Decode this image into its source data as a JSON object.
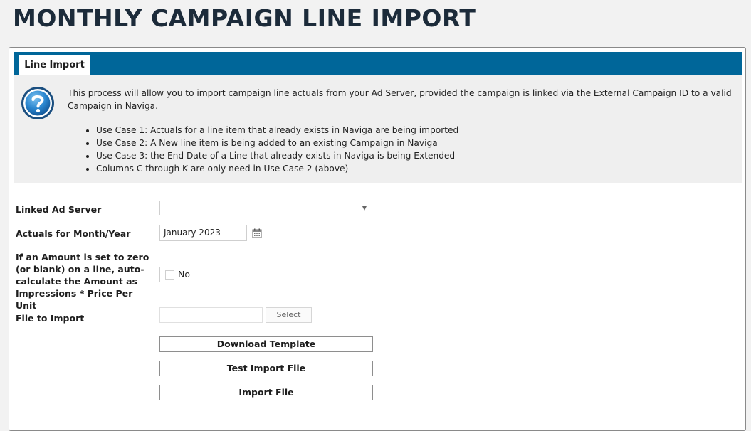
{
  "page": {
    "title": "MONTHLY CAMPAIGN LINE IMPORT"
  },
  "tabs": [
    {
      "label": "Line Import",
      "active": true
    }
  ],
  "info": {
    "icon": "question-mark-icon",
    "description": "This process will allow you to import campaign line actuals from your Ad Server, provided the campaign is linked via the External Campaign ID to a valid Campaign in Naviga.",
    "use_cases": [
      "Use Case 1: Actuals for a line item that already exists in Naviga are being imported",
      "Use Case 2: A New line item is being added to an existing Campaign in Naviga",
      "Use Case 3: the End Date of a Line that already exists in Naviga is being Extended",
      "Columns C through K are only need in Use Case 2 (above)"
    ]
  },
  "form": {
    "linked_ad_server": {
      "label": "Linked Ad Server",
      "value": ""
    },
    "actuals_month_year": {
      "label": "Actuals for Month/Year",
      "value": "January 2023",
      "icon": "calendar-icon"
    },
    "auto_calculate": {
      "label": "If an Amount is set to zero (or blank) on a line, auto-calculate the Amount as Impressions * Price Per Unit",
      "value_label": "No",
      "checked": false
    },
    "file_to_import": {
      "label": "File to Import",
      "value": "",
      "select_label": "Select"
    }
  },
  "actions": {
    "download_template": "Download Template",
    "test_import_file": "Test Import File",
    "import_file": "Import File"
  },
  "colors": {
    "tab_bar": "#006699",
    "info_background": "#efefef",
    "title": "#1c2b3a"
  }
}
